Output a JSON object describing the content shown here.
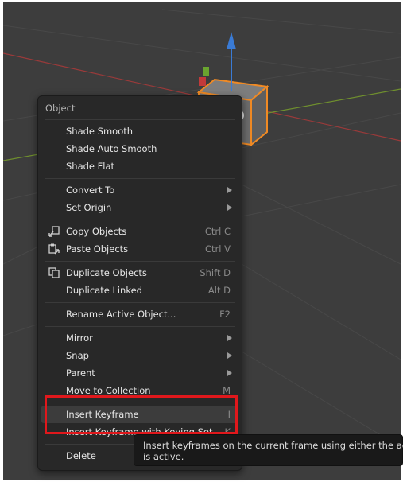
{
  "menu": {
    "title": "Object",
    "items": [
      {
        "label": "Shade Smooth"
      },
      {
        "label": "Shade Auto Smooth"
      },
      {
        "label": "Shade Flat"
      },
      {
        "label": "Convert To",
        "submenu": true
      },
      {
        "label": "Set Origin",
        "submenu": true
      },
      {
        "label": "Copy Objects",
        "shortcut": "Ctrl C",
        "icon": "copy-icon"
      },
      {
        "label": "Paste Objects",
        "shortcut": "Ctrl V",
        "icon": "paste-icon"
      },
      {
        "label": "Duplicate Objects",
        "shortcut": "Shift D",
        "icon": "duplicate-icon"
      },
      {
        "label": "Duplicate Linked",
        "shortcut": "Alt D"
      },
      {
        "label": "Rename Active Object...",
        "shortcut": "F2"
      },
      {
        "label": "Mirror",
        "submenu": true
      },
      {
        "label": "Snap",
        "submenu": true
      },
      {
        "label": "Parent",
        "submenu": true
      },
      {
        "label": "Move to Collection",
        "shortcut": "M"
      },
      {
        "label": "Insert Keyframe",
        "shortcut": "I",
        "highlighted": true
      },
      {
        "label": "Insert Keyframe with Keying Set",
        "shortcut": "K"
      },
      {
        "label": "Delete"
      }
    ]
  },
  "tooltip": {
    "line1": "Insert keyframes on the current frame using either the ac",
    "line2": "is active."
  },
  "colors": {
    "viewport": "#3d3d3d",
    "menu_bg": "#282828",
    "highlight_box": "#e0181c",
    "selection_outline": "#f08a24",
    "gizmo_z": "#3a7bd5"
  }
}
